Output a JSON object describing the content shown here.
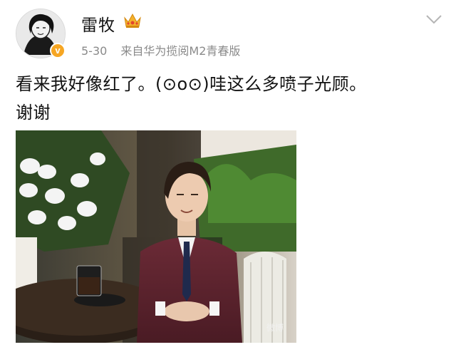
{
  "post": {
    "author": {
      "name": "雷牧",
      "avatar_icon": "avatar-portrait",
      "badge_icon": "verified-icon",
      "badge_letter": "v",
      "vip_icon": "crown-icon",
      "badge_color": "#f6a623"
    },
    "time": "5-30",
    "source": "来自华为揽阅M2青春版",
    "text_line1": "看来我好像红了。(⊙o⊙)哇这么多喷子光顾。",
    "text_line2": "谢谢",
    "menu_icon": "chevron-down-icon",
    "photo": {
      "description_icon": "photo",
      "watermark": "微博"
    }
  }
}
